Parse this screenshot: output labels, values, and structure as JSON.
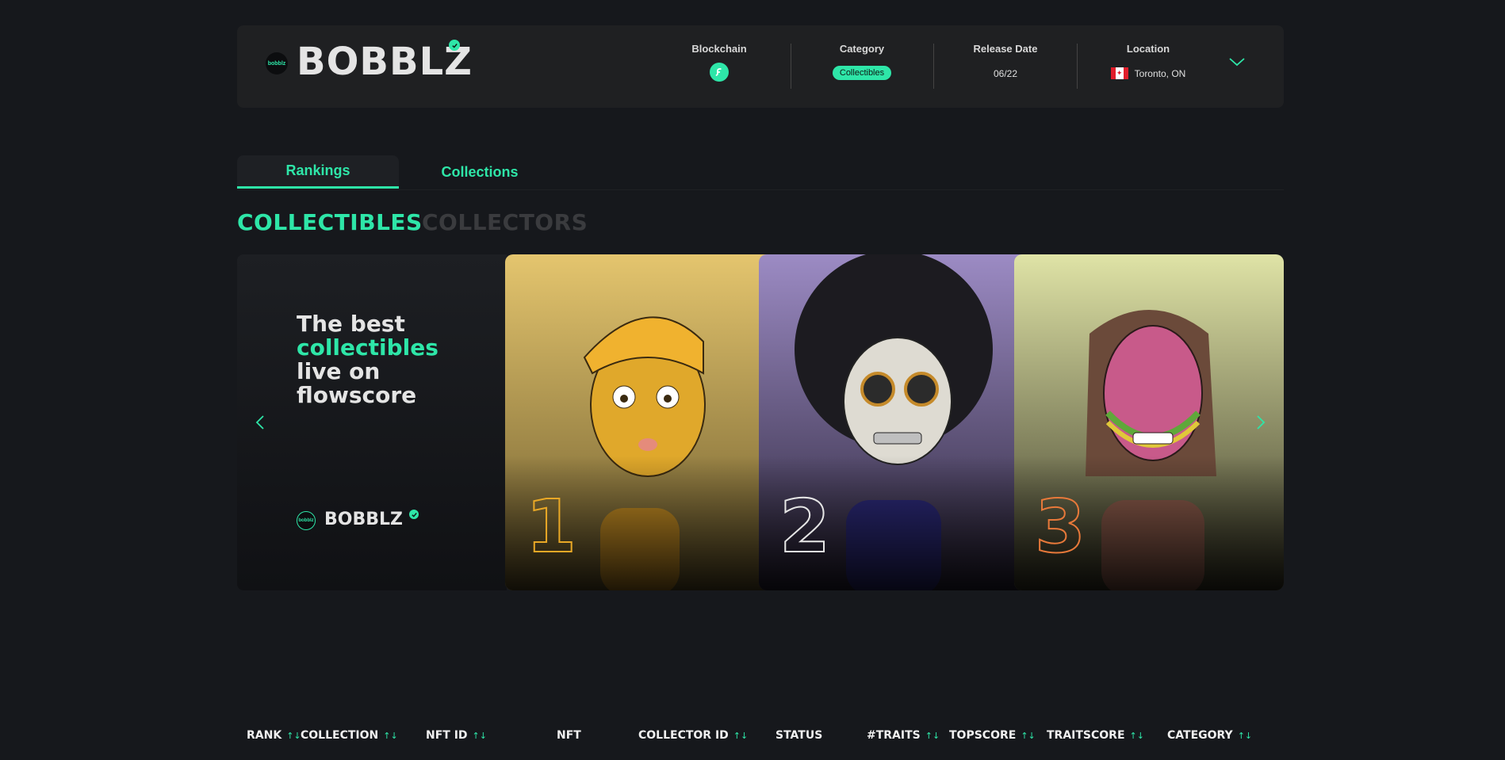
{
  "brand": {
    "logo_text": "bobblz",
    "title": "BOBBLZ"
  },
  "meta": {
    "blockchain_label": "Blockchain",
    "category_label": "Category",
    "category_value": "Collectibles",
    "release_label": "Release Date",
    "release_value": "06/22",
    "location_label": "Location",
    "location_value": "Toronto, ON"
  },
  "tabs": [
    {
      "label": "Rankings",
      "active": true
    },
    {
      "label": "Collections",
      "active": false
    }
  ],
  "segments": [
    {
      "label": "COLLECTIBLES",
      "active": true
    },
    {
      "label": "COLLECTORS",
      "active": false
    }
  ],
  "carousel": {
    "intro_line1": "The best",
    "intro_line2": "collectibles",
    "intro_line3": "live on",
    "intro_line4": "flowscore",
    "brand_small": "BOBBLZ",
    "cards": [
      {
        "rank": "1",
        "bg": "#e4c56e",
        "outline": "#e9a826"
      },
      {
        "rank": "2",
        "bg": "#9c8bc4",
        "outline": "#e6e6e6"
      },
      {
        "rank": "3",
        "bg": "#dfe3a6",
        "outline": "#e8793a"
      }
    ]
  },
  "table": {
    "headers": [
      {
        "label": "RANK",
        "sortable": true
      },
      {
        "label": "COLLECTION",
        "sortable": true
      },
      {
        "label": "NFT ID",
        "sortable": true
      },
      {
        "label": "NFT",
        "sortable": false
      },
      {
        "label": "COLLECTOR ID",
        "sortable": true
      },
      {
        "label": "STATUS",
        "sortable": false
      },
      {
        "label": "#TRAITS",
        "sortable": true
      },
      {
        "label": "TOPSCORE",
        "sortable": true
      },
      {
        "label": "TRAITSCORE",
        "sortable": true
      },
      {
        "label": "CATEGORY",
        "sortable": true
      }
    ],
    "sort_glyph": "↑↓"
  },
  "colors": {
    "accent": "#2ee6a8",
    "background": "#16181c",
    "card": "#1f2022"
  }
}
